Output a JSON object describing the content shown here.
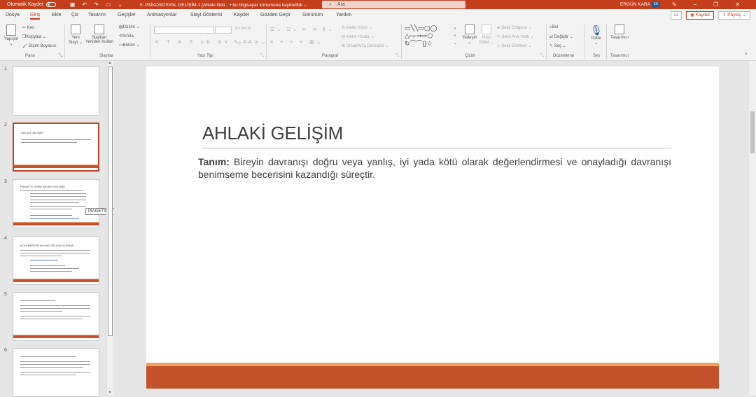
{
  "titlebar": {
    "autosave_label": "Otomatik Kaydet",
    "doc_title": "5. PSİKOSOSYAL GELİŞİM-1 [Ahlaki Geli... • bu bilgisayar konumuna kaydedildi ⌄",
    "search_placeholder": "Ara",
    "user_name": "ERGÜN KARA",
    "user_initials": "EK",
    "colors": {
      "accent": "#c43e1c"
    }
  },
  "menu": {
    "tabs": [
      "Dosya",
      "Giriş",
      "Ekle",
      "Çiz",
      "Tasarım",
      "Geçişler",
      "Animasyonlar",
      "Slayt Gösterisi",
      "Kaydet",
      "Gözden Geçir",
      "Görünüm",
      "Yardım"
    ],
    "active_tab": "Giriş",
    "record_label": "Kaydet",
    "share_label": "Paylaş"
  },
  "ribbon": {
    "pano": {
      "paste": "Yapıştır",
      "cut": "Kes",
      "copy": "Kopyala",
      "format_painter": "Biçim Boyacısı",
      "label": "Pano"
    },
    "slaytlar": {
      "new_slide_1": "Yeni",
      "new_slide_2": "Slayt",
      "reuse_1": "Slaytları",
      "reuse_2": "Yeniden Kullan",
      "layout": "Düzen",
      "reset": "Sıfırla",
      "section": "Bölüm",
      "label": "Slaytlar"
    },
    "yazitipi": {
      "label": "Yazı Tipi"
    },
    "paragraf": {
      "text_direction": "Metin Yönü",
      "align_text": "Metni Hizala",
      "smartart": "SmartArt'a Dönüştür",
      "label": "Paragraf"
    },
    "cizim": {
      "arrange": "Yerleştir",
      "quick_styles_1": "Hızlı",
      "quick_styles_2": "Stiller",
      "shape_fill": "Şekil Dolgusu",
      "shape_outline": "Şekil Ana Hattı",
      "shape_effects": "Şekil Efektleri",
      "label": "Çizim"
    },
    "duzenleme": {
      "find": "Bul",
      "replace": "Değiştir",
      "select": "Seç",
      "label": "Düzenleme"
    },
    "ses": {
      "dictate": "Dikte",
      "label": "Ses"
    },
    "tasarimci": {
      "designer": "Tasarımcı",
      "label": "Tasarımcı"
    }
  },
  "thumbnails": [
    {
      "num": "1",
      "title": ""
    },
    {
      "num": "2",
      "title": "AHLAKİ GELİŞİM"
    },
    {
      "num": "3",
      "title": "PİAGET'E GÖRE AHLAKİ GELİŞİM"
    },
    {
      "num": "4",
      "title": "KOHLBERG'İN AHLAKİ GELİŞİM KURAMI"
    },
    {
      "num": "5",
      "title": ""
    },
    {
      "num": "6",
      "title": ""
    }
  ],
  "tooltip": "PİAGET'E GÖRE AHLAKİ GELİŞİM",
  "slide": {
    "title": "AHLAKİ GELİŞİM",
    "body_bold": "Tanım:",
    "body_text": " Bireyin davranışı doğru veya yanlış, iyi yada kötü olarak değerlendirmesi ve onayladığı davranışı benimseme becerisini kazandığı süreçtir.",
    "colors": {
      "bar": "#c4522a",
      "bar_highlight": "#f0a060"
    }
  }
}
